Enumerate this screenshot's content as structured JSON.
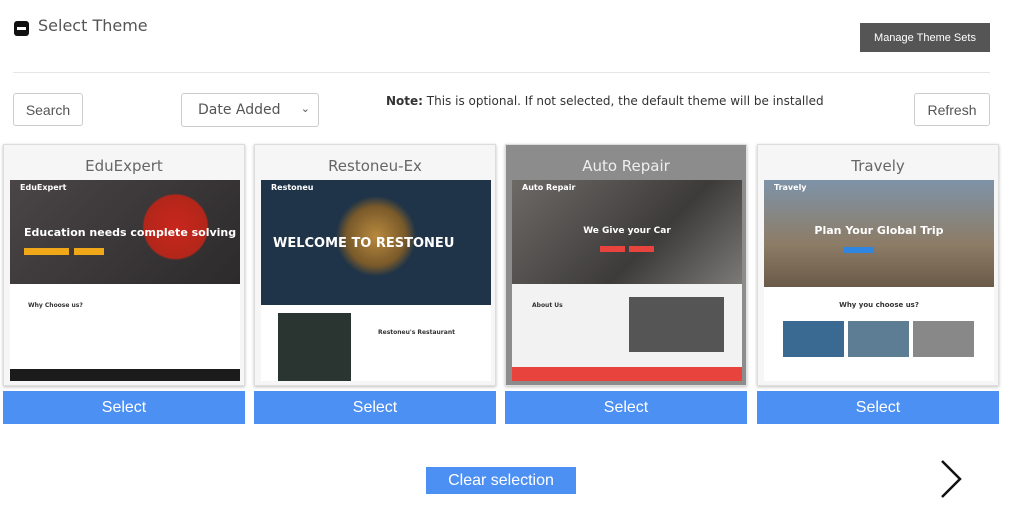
{
  "header": {
    "title": "Select Theme",
    "collapse_icon": "minus-square-icon",
    "manage_label": "Manage Theme Sets"
  },
  "toolbar": {
    "search_label": "Search",
    "sort_value": "Date Added",
    "note_label": "Note:",
    "note_text": " This is optional. If not selected, the default theme will be installed",
    "refresh_label": "Refresh"
  },
  "themes": [
    {
      "name": "EduExpert",
      "brand": "EduExpert",
      "headline": "Education needs complete solving",
      "section": "Why Choose us?",
      "select_label": "Select"
    },
    {
      "name": "Restoneu-Ex",
      "brand": "Restoneu",
      "headline": "WELCOME TO RESTONEU",
      "section": "Restoneu's Restaurant",
      "select_label": "Select"
    },
    {
      "name": "Auto Repair",
      "brand": "Auto Repair",
      "headline": "We Give your Car",
      "section": "About Us",
      "select_label": "Select",
      "highlighted": true
    },
    {
      "name": "Travely",
      "brand": "Travely",
      "headline": "Plan Your Global Trip",
      "section": "Why you choose us?",
      "select_label": "Select"
    }
  ],
  "footer": {
    "clear_label": "Clear selection",
    "next_icon": "chevron-right-icon"
  },
  "colors": {
    "accent": "#4d90f3",
    "manage_bg": "#555555"
  }
}
